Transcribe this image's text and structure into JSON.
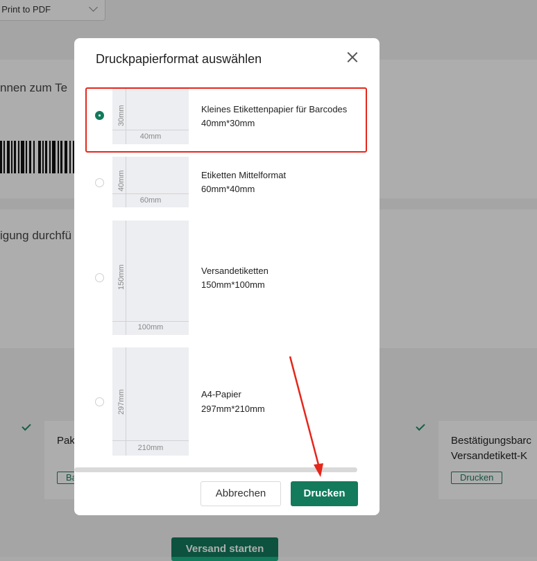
{
  "background": {
    "printer_select": "t Print to PDF",
    "scan_section_text": "nnen zum Te",
    "confirm_section_text": "igung durchfü",
    "card_left_title": "Pak",
    "card_left_button": "Ba",
    "card_right_title_line1": "Bestätigungsbarc",
    "card_right_title_line2": "Versandetikett-K",
    "card_right_button": "Drucken",
    "start_shipping_button": "Versand starten"
  },
  "modal": {
    "title": "Druckpapierformat auswählen",
    "options": [
      {
        "name": "Kleines Etikettenpapier für Barcodes",
        "size": "40mm*30mm",
        "width_label": "40mm",
        "height_label": "30mm",
        "selected": true
      },
      {
        "name": "Etiketten Mittelformat",
        "size": "60mm*40mm",
        "width_label": "60mm",
        "height_label": "40mm",
        "selected": false
      },
      {
        "name": "Versandetiketten",
        "size": "150mm*100mm",
        "width_label": "100mm",
        "height_label": "150mm",
        "selected": false
      },
      {
        "name": "A4-Papier",
        "size": "297mm*210mm",
        "width_label": "210mm",
        "height_label": "297mm",
        "selected": false
      }
    ],
    "cancel_label": "Abbrechen",
    "print_label": "Drucken"
  },
  "colors": {
    "primary": "#137a5c",
    "annotation_red": "#e5261b"
  }
}
